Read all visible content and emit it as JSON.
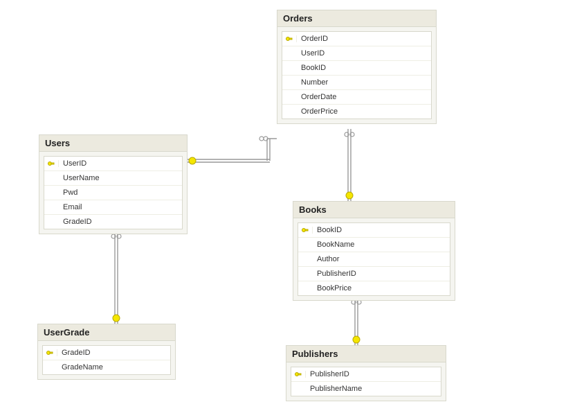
{
  "tables": {
    "orders": {
      "title": "Orders",
      "cols": [
        {
          "name": "OrderID",
          "pk": true
        },
        {
          "name": "UserID",
          "pk": false
        },
        {
          "name": "BookID",
          "pk": false
        },
        {
          "name": "Number",
          "pk": false
        },
        {
          "name": "OrderDate",
          "pk": false
        },
        {
          "name": "OrderPrice",
          "pk": false
        }
      ]
    },
    "users": {
      "title": "Users",
      "cols": [
        {
          "name": "UserID",
          "pk": true
        },
        {
          "name": "UserName",
          "pk": false
        },
        {
          "name": "Pwd",
          "pk": false
        },
        {
          "name": "Email",
          "pk": false
        },
        {
          "name": "GradeID",
          "pk": false
        }
      ]
    },
    "books": {
      "title": "Books",
      "cols": [
        {
          "name": "BookID",
          "pk": true
        },
        {
          "name": "BookName",
          "pk": false
        },
        {
          "name": "Author",
          "pk": false
        },
        {
          "name": "PublisherID",
          "pk": false
        },
        {
          "name": "BookPrice",
          "pk": false
        }
      ]
    },
    "usergrade": {
      "title": "UserGrade",
      "cols": [
        {
          "name": "GradeID",
          "pk": true
        },
        {
          "name": "GradeName",
          "pk": false
        }
      ]
    },
    "publishers": {
      "title": "Publishers",
      "cols": [
        {
          "name": "PublisherID",
          "pk": true
        },
        {
          "name": "PublisherName",
          "pk": false
        }
      ]
    }
  },
  "relationships": [
    {
      "from": "Users.UserID",
      "to": "Orders.UserID"
    },
    {
      "from": "Users.GradeID",
      "to": "UserGrade.GradeID"
    },
    {
      "from": "Orders.BookID",
      "to": "Books.BookID"
    },
    {
      "from": "Books.PublisherID",
      "to": "Publishers.PublisherID"
    }
  ]
}
